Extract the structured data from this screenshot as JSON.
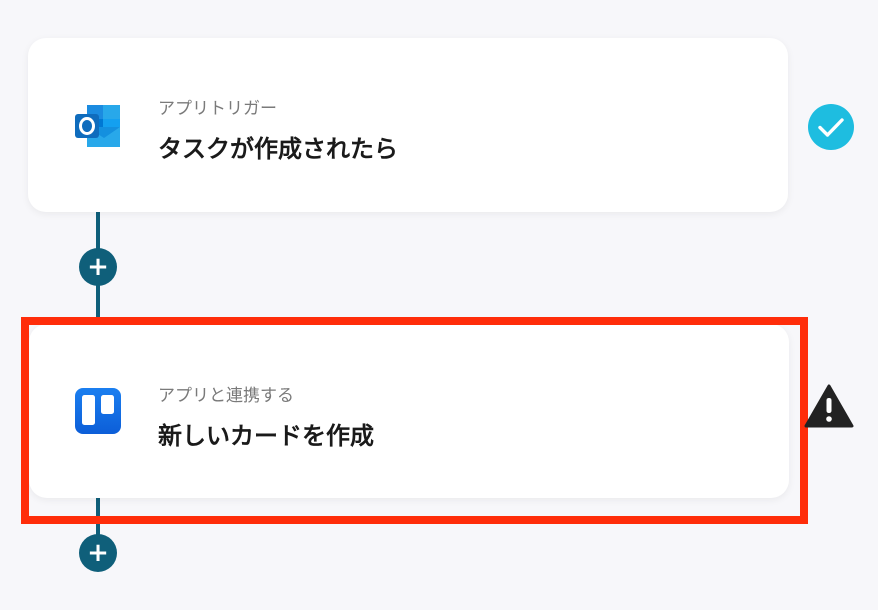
{
  "colors": {
    "background": "#f7f7fa",
    "connector": "#0f5f7a",
    "highlight": "#ff2d0a",
    "success": "#1ebde0",
    "warning": "#222222"
  },
  "steps": [
    {
      "subtitle": "アプリトリガー",
      "title": "タスクが作成されたら",
      "app_icon": "outlook-icon",
      "status": "complete",
      "status_icon": "check-circle-icon"
    },
    {
      "subtitle": "アプリと連携する",
      "title": "新しいカードを作成",
      "app_icon": "trello-icon",
      "status": "warning",
      "status_icon": "warning-triangle-icon",
      "highlighted": true
    }
  ],
  "add_step_symbol": "+"
}
